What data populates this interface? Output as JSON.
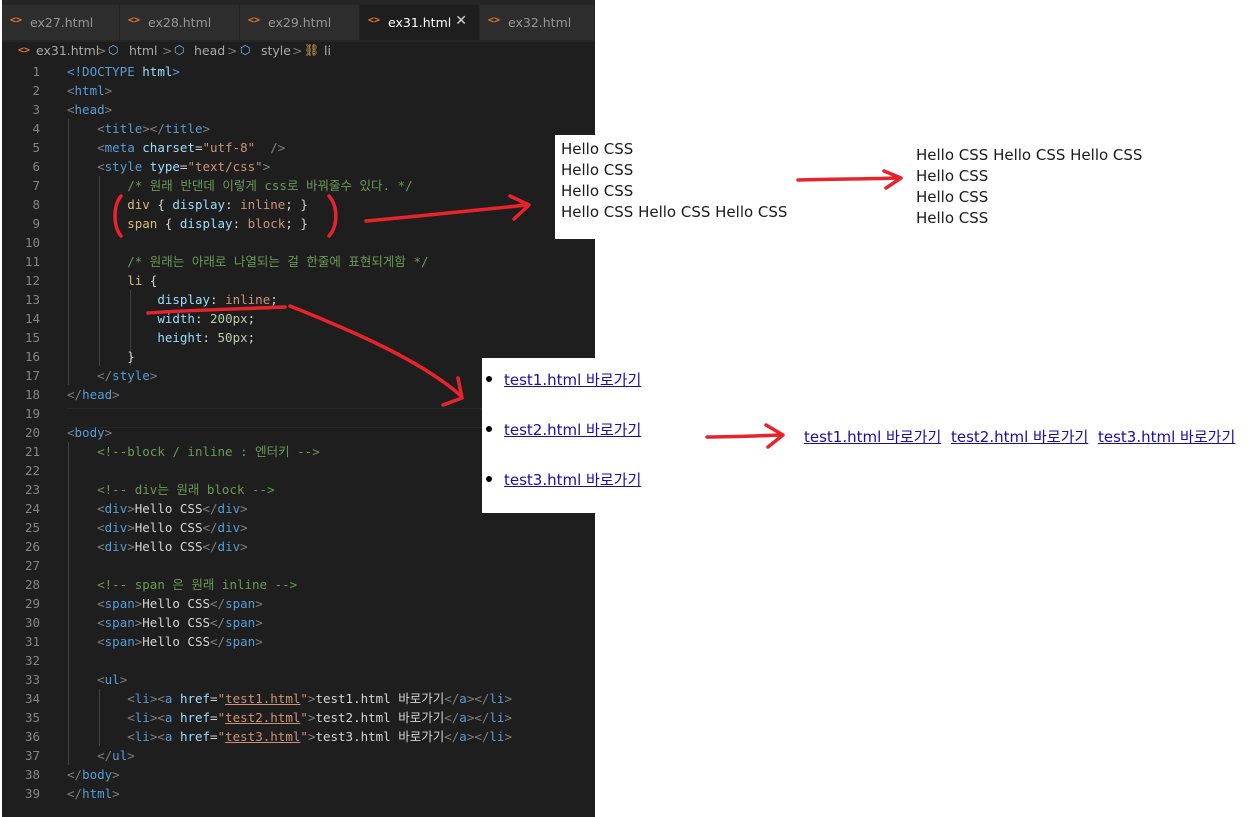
{
  "tabs": [
    {
      "icon": "<>",
      "label": "ex27.html"
    },
    {
      "icon": "<>",
      "label": "ex28.html"
    },
    {
      "icon": "<>",
      "label": "ex29.html"
    },
    {
      "icon": "<>",
      "label": "ex31.html",
      "active": true,
      "close": "✕"
    },
    {
      "icon": "<>",
      "label": "ex32.html"
    }
  ],
  "breadcrumb": {
    "file": "ex31.html",
    "items": [
      "html",
      "head",
      "style",
      "li"
    ],
    "separator": ">"
  },
  "editor": {
    "line_numbers": [
      "1",
      "2",
      "3",
      "4",
      "5",
      "6",
      "7",
      "8",
      "9",
      "10",
      "11",
      "12",
      "13",
      "14",
      "15",
      "16",
      "17",
      "18",
      "19",
      "20",
      "21",
      "22",
      "23",
      "24",
      "25",
      "26",
      "27",
      "28",
      "29",
      "30",
      "31",
      "32",
      "33",
      "34",
      "35",
      "36",
      "37",
      "38",
      "39"
    ],
    "colors": {
      "tag": "#569cd6",
      "attr": "#9cdcfe",
      "string": "#ce9178",
      "comment": "#6a9955",
      "selector": "#d7ba7d",
      "number": "#b5cea8"
    },
    "lines": [
      [
        [
          "tg",
          "<!DOCTYPE "
        ],
        [
          "at",
          "html"
        ],
        [
          "tg",
          ">"
        ]
      ],
      [
        [
          "pu",
          "<"
        ],
        [
          "tg",
          "html"
        ],
        [
          "pu",
          ">"
        ]
      ],
      [
        [
          "pu",
          "<"
        ],
        [
          "tg",
          "head"
        ],
        [
          "pu",
          ">"
        ]
      ],
      [
        [
          "tx",
          "    "
        ],
        [
          "pu",
          "<"
        ],
        [
          "tg",
          "title"
        ],
        [
          "pu",
          "></"
        ],
        [
          "tg",
          "title"
        ],
        [
          "pu",
          ">"
        ]
      ],
      [
        [
          "tx",
          "    "
        ],
        [
          "pu",
          "<"
        ],
        [
          "tg",
          "meta "
        ],
        [
          "at",
          "charset"
        ],
        [
          "tx",
          "="
        ],
        [
          "st",
          "\"utf-8\""
        ],
        [
          "tx",
          "  "
        ],
        [
          "pu",
          "/>"
        ]
      ],
      [
        [
          "tx",
          "    "
        ],
        [
          "pu",
          "<"
        ],
        [
          "tg",
          "style "
        ],
        [
          "at",
          "type"
        ],
        [
          "tx",
          "="
        ],
        [
          "st",
          "\"text/css\""
        ],
        [
          "pu",
          ">"
        ]
      ],
      [
        [
          "tx",
          "        "
        ],
        [
          "cm",
          "/* 원래 반댄데 이렇게 css로 바꿔줄수 있다. */"
        ]
      ],
      [
        [
          "tx",
          "        "
        ],
        [
          "sl",
          "div"
        ],
        [
          "tx",
          " { "
        ],
        [
          "at",
          "display"
        ],
        [
          "tx",
          ": "
        ],
        [
          "st",
          "inline"
        ],
        [
          "tx",
          "; }"
        ]
      ],
      [
        [
          "tx",
          "        "
        ],
        [
          "sl",
          "span"
        ],
        [
          "tx",
          " { "
        ],
        [
          "at",
          "display"
        ],
        [
          "tx",
          ": "
        ],
        [
          "st",
          "block"
        ],
        [
          "tx",
          "; }"
        ]
      ],
      [],
      [
        [
          "tx",
          "        "
        ],
        [
          "cm",
          "/* 원래는 아래로 나열되는 걸 한줄에 표현되게함 */"
        ]
      ],
      [
        [
          "tx",
          "        "
        ],
        [
          "sl",
          "li"
        ],
        [
          "tx",
          " {"
        ]
      ],
      [
        [
          "tx",
          "            "
        ],
        [
          "at",
          "display"
        ],
        [
          "tx",
          ": "
        ],
        [
          "st",
          "inline"
        ],
        [
          "tx",
          ";"
        ]
      ],
      [
        [
          "tx",
          "            "
        ],
        [
          "at",
          "width"
        ],
        [
          "tx",
          ": "
        ],
        [
          "nm",
          "200px"
        ],
        [
          "tx",
          ";"
        ]
      ],
      [
        [
          "tx",
          "            "
        ],
        [
          "at",
          "height"
        ],
        [
          "tx",
          ": "
        ],
        [
          "nm",
          "50px"
        ],
        [
          "tx",
          ";"
        ]
      ],
      [
        [
          "tx",
          "        }"
        ]
      ],
      [
        [
          "tx",
          "    "
        ],
        [
          "pu",
          "</"
        ],
        [
          "tg",
          "style"
        ],
        [
          "pu",
          ">"
        ]
      ],
      [
        [
          "pu",
          "</"
        ],
        [
          "tg",
          "head"
        ],
        [
          "pu",
          ">"
        ]
      ],
      [],
      [
        [
          "pu",
          "<"
        ],
        [
          "tg",
          "body"
        ],
        [
          "pu",
          ">"
        ]
      ],
      [
        [
          "tx",
          "    "
        ],
        [
          "cm",
          "<!--block / inline : 엔터키 -->"
        ]
      ],
      [],
      [
        [
          "tx",
          "    "
        ],
        [
          "cm",
          "<!-- div는 원래 block -->"
        ]
      ],
      [
        [
          "tx",
          "    "
        ],
        [
          "pu",
          "<"
        ],
        [
          "tg",
          "div"
        ],
        [
          "pu",
          ">"
        ],
        [
          "tx",
          "Hello CSS"
        ],
        [
          "pu",
          "</"
        ],
        [
          "tg",
          "div"
        ],
        [
          "pu",
          ">"
        ]
      ],
      [
        [
          "tx",
          "    "
        ],
        [
          "pu",
          "<"
        ],
        [
          "tg",
          "div"
        ],
        [
          "pu",
          ">"
        ],
        [
          "tx",
          "Hello CSS"
        ],
        [
          "pu",
          "</"
        ],
        [
          "tg",
          "div"
        ],
        [
          "pu",
          ">"
        ]
      ],
      [
        [
          "tx",
          "    "
        ],
        [
          "pu",
          "<"
        ],
        [
          "tg",
          "div"
        ],
        [
          "pu",
          ">"
        ],
        [
          "tx",
          "Hello CSS"
        ],
        [
          "pu",
          "</"
        ],
        [
          "tg",
          "div"
        ],
        [
          "pu",
          ">"
        ]
      ],
      [],
      [
        [
          "tx",
          "    "
        ],
        [
          "cm",
          "<!-- span 은 원래 inline -->"
        ]
      ],
      [
        [
          "tx",
          "    "
        ],
        [
          "pu",
          "<"
        ],
        [
          "tg",
          "span"
        ],
        [
          "pu",
          ">"
        ],
        [
          "tx",
          "Hello CSS"
        ],
        [
          "pu",
          "</"
        ],
        [
          "tg",
          "span"
        ],
        [
          "pu",
          ">"
        ]
      ],
      [
        [
          "tx",
          "    "
        ],
        [
          "pu",
          "<"
        ],
        [
          "tg",
          "span"
        ],
        [
          "pu",
          ">"
        ],
        [
          "tx",
          "Hello CSS"
        ],
        [
          "pu",
          "</"
        ],
        [
          "tg",
          "span"
        ],
        [
          "pu",
          ">"
        ]
      ],
      [
        [
          "tx",
          "    "
        ],
        [
          "pu",
          "<"
        ],
        [
          "tg",
          "span"
        ],
        [
          "pu",
          ">"
        ],
        [
          "tx",
          "Hello CSS"
        ],
        [
          "pu",
          "</"
        ],
        [
          "tg",
          "span"
        ],
        [
          "pu",
          ">"
        ]
      ],
      [],
      [
        [
          "tx",
          "    "
        ],
        [
          "pu",
          "<"
        ],
        [
          "tg",
          "ul"
        ],
        [
          "pu",
          ">"
        ]
      ],
      [
        [
          "tx",
          "        "
        ],
        [
          "pu",
          "<"
        ],
        [
          "tg",
          "li"
        ],
        [
          "pu",
          "><"
        ],
        [
          "tg",
          "a "
        ],
        [
          "at",
          "href"
        ],
        [
          "tx",
          "="
        ],
        [
          "st",
          "\""
        ],
        [
          "stu",
          "test1.html"
        ],
        [
          "st",
          "\""
        ],
        [
          "pu",
          ">"
        ],
        [
          "tx",
          "test1.html 바로가기"
        ],
        [
          "pu",
          "</"
        ],
        [
          "tg",
          "a"
        ],
        [
          "pu",
          "></"
        ],
        [
          "tg",
          "li"
        ],
        [
          "pu",
          ">"
        ]
      ],
      [
        [
          "tx",
          "        "
        ],
        [
          "pu",
          "<"
        ],
        [
          "tg",
          "li"
        ],
        [
          "pu",
          "><"
        ],
        [
          "tg",
          "a "
        ],
        [
          "at",
          "href"
        ],
        [
          "tx",
          "="
        ],
        [
          "st",
          "\""
        ],
        [
          "stu",
          "test2.html"
        ],
        [
          "st",
          "\""
        ],
        [
          "pu",
          ">"
        ],
        [
          "tx",
          "test2.html 바로가기"
        ],
        [
          "pu",
          "</"
        ],
        [
          "tg",
          "a"
        ],
        [
          "pu",
          "></"
        ],
        [
          "tg",
          "li"
        ],
        [
          "pu",
          ">"
        ]
      ],
      [
        [
          "tx",
          "        "
        ],
        [
          "pu",
          "<"
        ],
        [
          "tg",
          "li"
        ],
        [
          "pu",
          "><"
        ],
        [
          "tg",
          "a "
        ],
        [
          "at",
          "href"
        ],
        [
          "tx",
          "="
        ],
        [
          "st",
          "\""
        ],
        [
          "stu",
          "test3.html"
        ],
        [
          "st",
          "\""
        ],
        [
          "pu",
          ">"
        ],
        [
          "tx",
          "test3.html 바로가기"
        ],
        [
          "pu",
          "</"
        ],
        [
          "tg",
          "a"
        ],
        [
          "pu",
          "></"
        ],
        [
          "tg",
          "li"
        ],
        [
          "pu",
          ">"
        ]
      ],
      [
        [
          "tx",
          "    "
        ],
        [
          "pu",
          "</"
        ],
        [
          "tg",
          "ul"
        ],
        [
          "pu",
          ">"
        ]
      ],
      [
        [
          "pu",
          "</"
        ],
        [
          "tg",
          "body"
        ],
        [
          "pu",
          ">"
        ]
      ],
      [
        [
          "pu",
          "</"
        ],
        [
          "tg",
          "html"
        ],
        [
          "pu",
          ">"
        ]
      ]
    ]
  },
  "output_before_div_span": {
    "divs": [
      "Hello CSS",
      "Hello CSS",
      "Hello CSS"
    ],
    "spans_line": "Hello CSS Hello CSS Hello CSS"
  },
  "output_after_div_span": {
    "divs_line": "Hello CSS Hello CSS Hello CSS",
    "spans": [
      "Hello CSS",
      "Hello CSS",
      "Hello CSS"
    ]
  },
  "output_before_list": {
    "links": [
      "test1.html 바로가기",
      "test2.html 바로가기",
      "test3.html 바로가기"
    ]
  },
  "output_after_list": {
    "links": [
      "test1.html 바로가기",
      "test2.html 바로가기",
      "test3.html 바로가기"
    ]
  },
  "annotation_color": "#e8232b"
}
